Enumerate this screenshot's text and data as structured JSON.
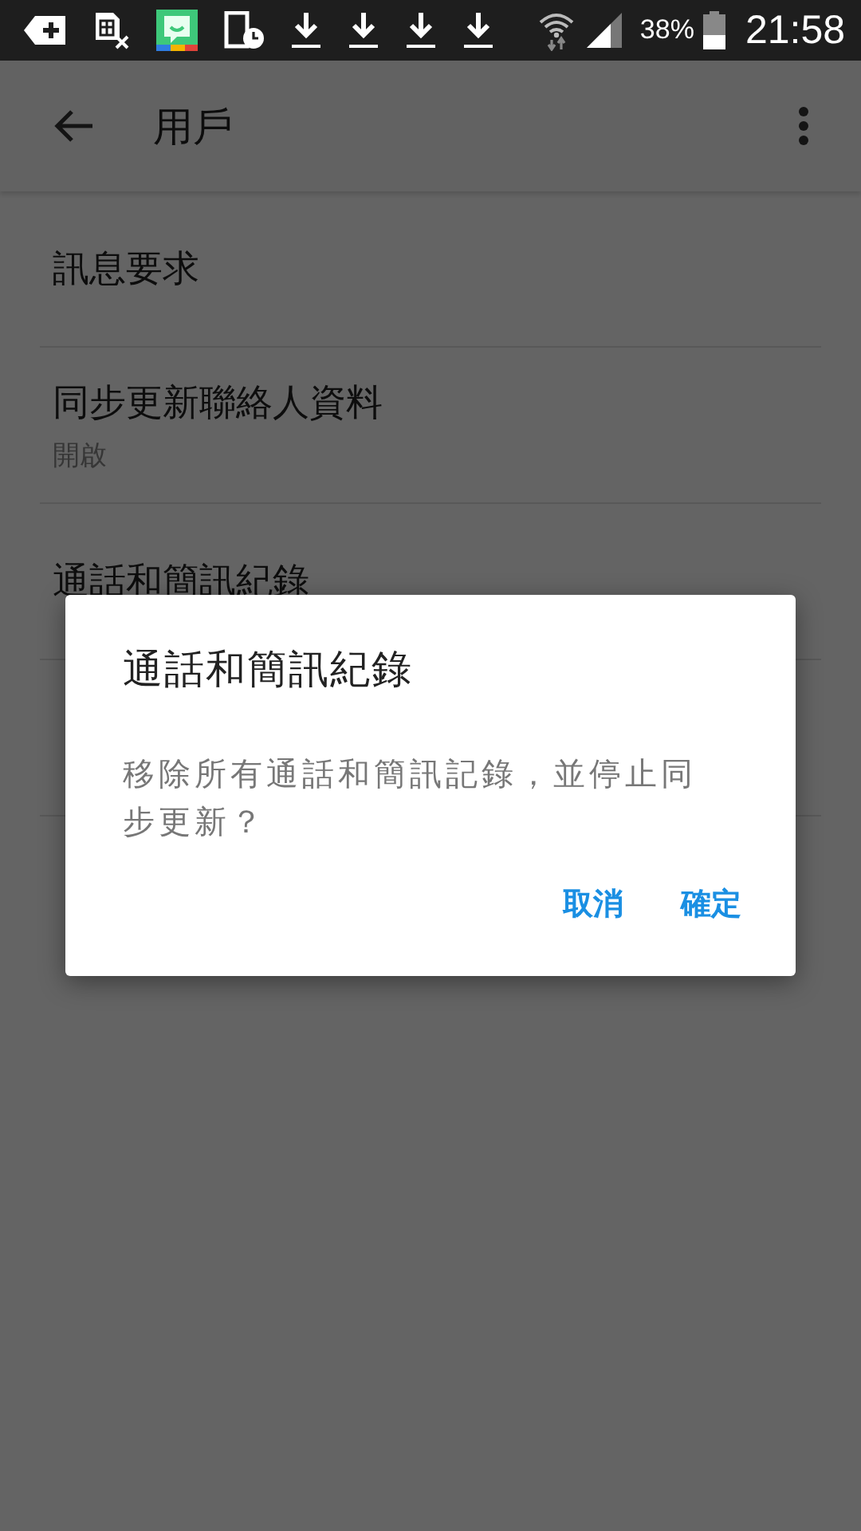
{
  "status_bar": {
    "battery": "38%",
    "time": "21:58"
  },
  "app_bar": {
    "title": "用戶"
  },
  "settings": [
    {
      "title": "訊息要求"
    },
    {
      "title": "同步更新聯絡人資料",
      "subtitle": "開啟"
    },
    {
      "title": "通話和簡訊紀錄"
    }
  ],
  "dialog": {
    "title": "通話和簡訊紀錄",
    "message": "移除所有通話和簡訊記錄，並停止同步更新？",
    "buttons": [
      "取消",
      "確定"
    ]
  }
}
